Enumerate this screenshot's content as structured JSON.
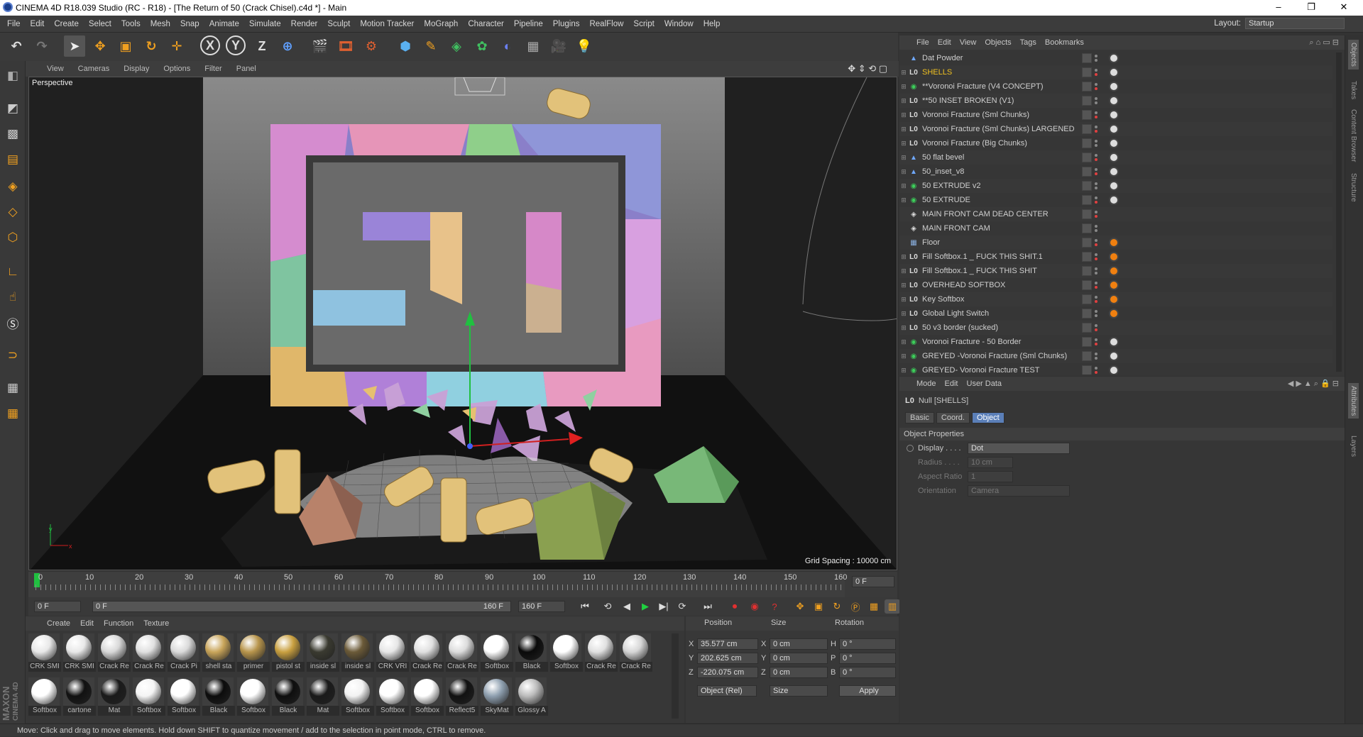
{
  "window": {
    "title": "CINEMA 4D R18.039 Studio (RC - R18) - [The Return of 50 (Crack Chisel).c4d *] - Main",
    "min": "–",
    "max": "❐",
    "close": "✕"
  },
  "menu": [
    "File",
    "Edit",
    "Create",
    "Select",
    "Tools",
    "Mesh",
    "Snap",
    "Animate",
    "Simulate",
    "Render",
    "Sculpt",
    "Motion Tracker",
    "MoGraph",
    "Character",
    "Pipeline",
    "Plugins",
    "RealFlow",
    "Script",
    "Window",
    "Help"
  ],
  "layout": {
    "label": "Layout:",
    "value": "Startup"
  },
  "toolbar": {
    "x": "X",
    "y": "Y",
    "z": "Z"
  },
  "viewport": {
    "menu": [
      "View",
      "Cameras",
      "Display",
      "Options",
      "Filter",
      "Panel"
    ],
    "camera": "Perspective",
    "grid": "Grid Spacing : 10000 cm",
    "axis_y": "y",
    "axis_x": "x"
  },
  "timeline": {
    "ticks": [
      "0",
      "10",
      "20",
      "30",
      "40",
      "50",
      "60",
      "70",
      "80",
      "90",
      "100",
      "110",
      "120",
      "130",
      "140",
      "150",
      "160"
    ],
    "current": "0 F"
  },
  "transport": {
    "start": "0 F",
    "range_start": "0 F",
    "range_end": "160 F",
    "end": "160 F"
  },
  "materials": {
    "menu": [
      "Create",
      "Edit",
      "Function",
      "Texture"
    ],
    "row1": [
      [
        "CRK SMI",
        "#e8e8e8"
      ],
      [
        "CRK SMI",
        "#e8e8e8"
      ],
      [
        "Crack Re",
        "#d8d8d8"
      ],
      [
        "Crack Re",
        "#e0e0e0"
      ],
      [
        "Crack Pi",
        "#dadada"
      ],
      [
        "shell sta",
        "#c9a55a"
      ],
      [
        "primer",
        "#b8954c"
      ],
      [
        "pistol st",
        "#c9a040"
      ],
      [
        "inside sl",
        "#3a3a30"
      ],
      [
        "inside sl",
        "#6b5a38"
      ],
      [
        "CRK VRI",
        "#e6e6e6"
      ],
      [
        "Crack Re",
        "#e0e0e0"
      ],
      [
        "Crack Re",
        "#dcdcdc"
      ],
      [
        "Softbox",
        "#ffffff"
      ],
      [
        "Black",
        "#0a0a0a"
      ],
      [
        "Softbox",
        "#ffffff"
      ],
      [
        "Crack Re",
        "#e0e0e0"
      ],
      [
        "Crack Re",
        "#d6d6d6"
      ]
    ],
    "row2": [
      [
        "Softbox",
        "#ffffff"
      ],
      [
        "cartone",
        "#111111"
      ],
      [
        "Mat",
        "#1a1a1a"
      ],
      [
        "Softbox",
        "#f4f4f4"
      ],
      [
        "Softbox",
        "#ffffff"
      ],
      [
        "Black",
        "#0c0c0c"
      ],
      [
        "Softbox",
        "#ffffff"
      ],
      [
        "Black",
        "#0e0e0e"
      ],
      [
        "Mat",
        "#1a1a1a"
      ],
      [
        "Softbox",
        "#f2f2f2"
      ],
      [
        "Softbox",
        "#ffffff"
      ],
      [
        "Softbox",
        "#ffffff"
      ],
      [
        "Reflect5",
        "#111111"
      ],
      [
        "SkyMat",
        "#8fa0b0"
      ],
      [
        "Glossy A",
        "#bcbcbc"
      ]
    ]
  },
  "coords": {
    "headers": [
      "Position",
      "Size",
      "Rotation"
    ],
    "rows": [
      {
        "a": "X",
        "pos": "35.577 cm",
        "b": "X",
        "size": "0 cm",
        "c": "H",
        "rot": "0 °"
      },
      {
        "a": "Y",
        "pos": "202.625 cm",
        "b": "Y",
        "size": "0 cm",
        "c": "P",
        "rot": "0 °"
      },
      {
        "a": "Z",
        "pos": "-220.075 cm",
        "b": "Z",
        "size": "0 cm",
        "c": "B",
        "rot": "0 °"
      }
    ],
    "mode": "Object (Rel)",
    "size_mode": "Size",
    "apply": "Apply"
  },
  "objects": {
    "menu": [
      "File",
      "Edit",
      "View",
      "Objects",
      "Tags",
      "Bookmarks"
    ],
    "items": [
      {
        "name": "Dat Powder",
        "color": "#cfcfcf",
        "icon": "emitter-icon"
      },
      {
        "name": "SHELLS",
        "color": "#f0c020",
        "icon": "null-icon"
      },
      {
        "name": "**Voronoi Fracture (V4 CONCEPT)",
        "color": "#cfcfcf",
        "icon": "voronoi-icon"
      },
      {
        "name": "**50 INSET BROKEN (V1)",
        "color": "#cfcfcf",
        "icon": "null-icon"
      },
      {
        "name": "Voronoi Fracture (Sml Chunks)",
        "color": "#cfcfcf",
        "icon": "null-icon"
      },
      {
        "name": "Voronoi Fracture (Sml Chunks) LARGENED",
        "color": "#cfcfcf",
        "icon": "null-icon"
      },
      {
        "name": "Voronoi Fracture (Big Chunks)",
        "color": "#cfcfcf",
        "icon": "null-icon"
      },
      {
        "name": "50 flat bevel",
        "color": "#cfcfcf",
        "icon": "polygon-icon"
      },
      {
        "name": "50_inset_v8",
        "color": "#cfcfcf",
        "icon": "polygon-icon"
      },
      {
        "name": "50 EXTRUDE v2",
        "color": "#cfcfcf",
        "icon": "extrude-icon"
      },
      {
        "name": "50 EXTRUDE",
        "color": "#cfcfcf",
        "icon": "extrude-icon"
      },
      {
        "name": "MAIN FRONT CAM DEAD CENTER",
        "color": "#cfcfcf",
        "icon": "camera-icon"
      },
      {
        "name": "MAIN FRONT CAM",
        "color": "#cfcfcf",
        "icon": "camera-icon"
      },
      {
        "name": "Floor",
        "color": "#cfcfcf",
        "icon": "floor-icon"
      },
      {
        "name": "Fill Softbox.1 _ FUCK THIS SHIT.1",
        "color": "#cfcfcf",
        "icon": "null-icon"
      },
      {
        "name": "Fill Softbox.1 _ FUCK THIS SHIT",
        "color": "#cfcfcf",
        "icon": "null-icon"
      },
      {
        "name": "OVERHEAD SOFTBOX",
        "color": "#cfcfcf",
        "icon": "null-icon"
      },
      {
        "name": "Key Softbox",
        "color": "#cfcfcf",
        "icon": "null-icon"
      },
      {
        "name": "Global Light Switch",
        "color": "#cfcfcf",
        "icon": "null-icon"
      },
      {
        "name": "50 v3 border (sucked)",
        "color": "#cfcfcf",
        "icon": "null-icon"
      },
      {
        "name": "Voronoi Fracture - 50 Border",
        "color": "#cfcfcf",
        "icon": "voronoi-icon"
      },
      {
        "name": "GREYED -Voronoi Fracture (Sml Chunks)",
        "color": "#cfcfcf",
        "icon": "voronoi-icon"
      },
      {
        "name": "GREYED- Voronoi Fracture TEST",
        "color": "#cfcfcf",
        "icon": "voronoi-icon"
      }
    ]
  },
  "attributes": {
    "menu": [
      "Mode",
      "Edit",
      "User Data"
    ],
    "object": "Null [SHELLS]",
    "tabs": [
      "Basic",
      "Coord.",
      "Object"
    ],
    "section": "Object Properties",
    "props": [
      {
        "label": "Display . . . .",
        "value": "Dot"
      },
      {
        "label": "Radius . . . .",
        "value": "10 cm"
      },
      {
        "label": "Aspect Ratio",
        "value": "1"
      },
      {
        "label": "Orientation",
        "value": "Camera"
      }
    ]
  },
  "rightstrip": [
    "Objects",
    "Takes",
    "Content Browser",
    "Structure",
    "Attributes",
    "Layers"
  ],
  "brand": {
    "a": "MAXON",
    "b": "CINEMA 4D"
  },
  "status": "Move: Click and drag to move elements. Hold down SHIFT to quantize movement / add to the selection in point mode, CTRL to remove."
}
